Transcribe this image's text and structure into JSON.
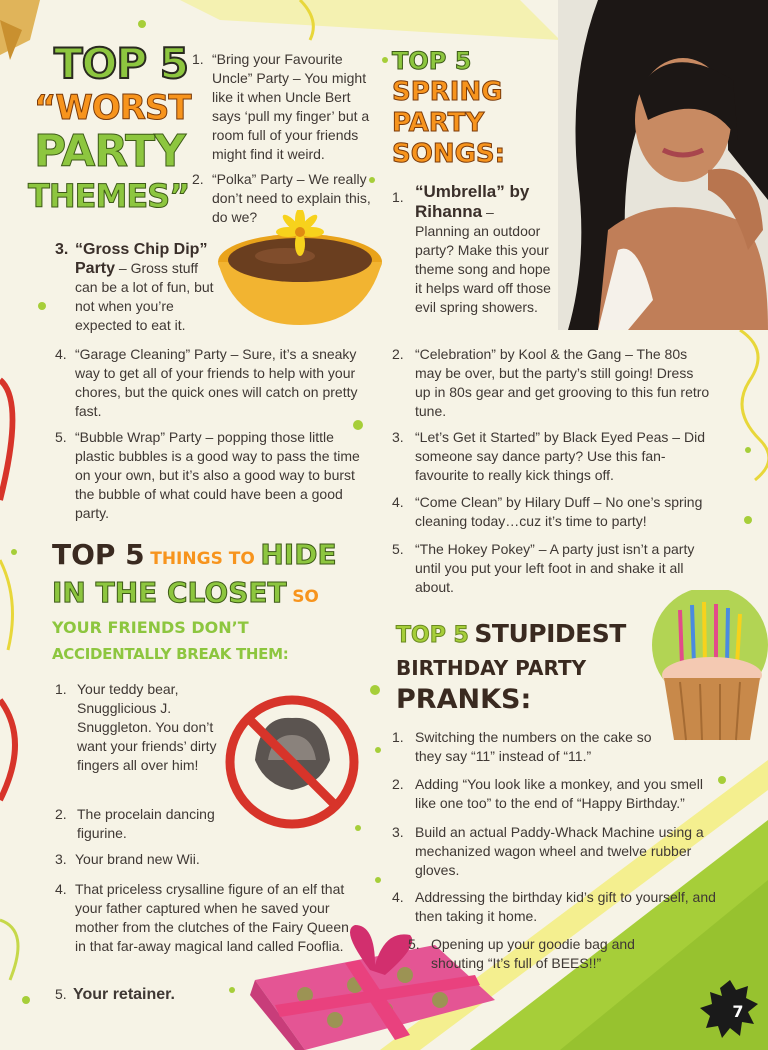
{
  "worst": {
    "heading": [
      "TOP 5",
      "“WORST",
      "PARTY",
      "THEMES”"
    ],
    "items": [
      {
        "num": "1.",
        "text": "“Bring your Favourite Uncle” Party – You might like it when Uncle Bert says ‘pull my finger’ but a room full of your friends might find it weird."
      },
      {
        "num": "2.",
        "text": "“Polka” Party – We really don’t need to explain this, do we?"
      },
      {
        "num": "3.",
        "title": "“Gross Chip Dip” Party",
        "text": " – Gross stuff can be a lot of fun, but not when you’re expected to eat it."
      },
      {
        "num": "4.",
        "text": "“Garage Cleaning” Party – Sure, it’s a sneaky way to get all of your friends to help with your chores, but the quick ones will catch on pretty fast."
      },
      {
        "num": "5.",
        "text": "“Bubble Wrap” Party – popping those little plastic bubbles is a good way to pass the time on your own, but it’s also a good way to burst the bubble of what could have been a good party."
      }
    ]
  },
  "closet": {
    "heading": {
      "top5": "TOP 5",
      "things": "THINGS TO",
      "hide": "HIDE",
      "in_closet": "IN THE CLOSET",
      "so": "SO",
      "line3": "YOUR FRIENDS DON’T",
      "line4": "ACCIDENTALLY BREAK THEM:"
    },
    "items": [
      {
        "num": "1.",
        "text": "Your teddy bear, Snugglicious J. Snuggleton. You don’t want your friends’ dirty fingers all over him!"
      },
      {
        "num": "2.",
        "text": "The procelain dancing figurine."
      },
      {
        "num": "3.",
        "text": "Your brand new Wii."
      },
      {
        "num": "4.",
        "text": "That priceless crysalline figure of an elf that your father captured when he saved your mother from the clutches of the Fairy Queen in that far-away magical land called Fooflia."
      },
      {
        "num": "5.",
        "text": "Your retainer."
      }
    ]
  },
  "spring": {
    "heading": [
      "TOP 5",
      "SPRING",
      "PARTY",
      "SONGS:"
    ],
    "items": [
      {
        "num": "1.",
        "title": "“Umbrella” by Rihanna",
        "text": " – Planning an outdoor party? Make this your theme song and hope it helps ward off those evil spring showers."
      },
      {
        "num": "2.",
        "text": "“Celebration” by Kool & the Gang – The 80s may be over, but the party’s still going! Dress up in 80s gear and get grooving to this fun retro tune."
      },
      {
        "num": "3.",
        "text": "“Let’s Get it Started” by Black Eyed Peas – Did someone say dance party? Use this fan-favourite to really kick things off."
      },
      {
        "num": "4.",
        "text": "“Come Clean” by Hilary Duff – No one’s spring cleaning today…cuz it’s time to party!"
      },
      {
        "num": "5.",
        "text": "“The Hokey Pokey” – A party just isn’t a party until you put your left foot in and shake it all about."
      }
    ]
  },
  "pranks": {
    "heading": {
      "top5": "TOP 5",
      "stupidest": "STUPIDEST",
      "line2": "BIRTHDAY PARTY",
      "line3": "PRANKS:"
    },
    "items": [
      {
        "num": "1.",
        "text": "Switching the numbers on the cake so they say “11” instead of “11.”"
      },
      {
        "num": "2.",
        "text": "Adding “You look like a monkey, and you smell like one too” to the end of “Happy Birthday.”"
      },
      {
        "num": "3.",
        "text": "Build an actual Paddy-Whack Machine using a mechanized wagon wheel and twelve rubber gloves."
      },
      {
        "num": "4.",
        "text": "Addressing the birthday kid’s gift to yourself, and then taking it home."
      },
      {
        "num": "5.",
        "text": "Opening up your goodie bag and shouting “It’s full of BEES!!”"
      }
    ]
  },
  "page_number": "7",
  "colors": {
    "orange": "#f7941d",
    "green": "#8dc63f",
    "dark": "#3a2a20",
    "lime": "#a6ce39"
  }
}
